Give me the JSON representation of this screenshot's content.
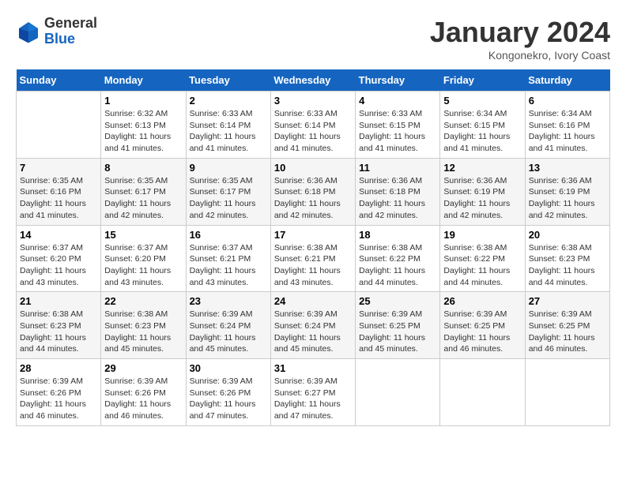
{
  "header": {
    "logo_general": "General",
    "logo_blue": "Blue",
    "title": "January 2024",
    "subtitle": "Kongonekro, Ivory Coast"
  },
  "columns": [
    "Sunday",
    "Monday",
    "Tuesday",
    "Wednesday",
    "Thursday",
    "Friday",
    "Saturday"
  ],
  "weeks": [
    {
      "days": [
        {
          "num": "",
          "info": ""
        },
        {
          "num": "1",
          "info": "Sunrise: 6:32 AM\nSunset: 6:13 PM\nDaylight: 11 hours\nand 41 minutes."
        },
        {
          "num": "2",
          "info": "Sunrise: 6:33 AM\nSunset: 6:14 PM\nDaylight: 11 hours\nand 41 minutes."
        },
        {
          "num": "3",
          "info": "Sunrise: 6:33 AM\nSunset: 6:14 PM\nDaylight: 11 hours\nand 41 minutes."
        },
        {
          "num": "4",
          "info": "Sunrise: 6:33 AM\nSunset: 6:15 PM\nDaylight: 11 hours\nand 41 minutes."
        },
        {
          "num": "5",
          "info": "Sunrise: 6:34 AM\nSunset: 6:15 PM\nDaylight: 11 hours\nand 41 minutes."
        },
        {
          "num": "6",
          "info": "Sunrise: 6:34 AM\nSunset: 6:16 PM\nDaylight: 11 hours\nand 41 minutes."
        }
      ]
    },
    {
      "days": [
        {
          "num": "7",
          "info": "Sunrise: 6:35 AM\nSunset: 6:16 PM\nDaylight: 11 hours\nand 41 minutes."
        },
        {
          "num": "8",
          "info": "Sunrise: 6:35 AM\nSunset: 6:17 PM\nDaylight: 11 hours\nand 42 minutes."
        },
        {
          "num": "9",
          "info": "Sunrise: 6:35 AM\nSunset: 6:17 PM\nDaylight: 11 hours\nand 42 minutes."
        },
        {
          "num": "10",
          "info": "Sunrise: 6:36 AM\nSunset: 6:18 PM\nDaylight: 11 hours\nand 42 minutes."
        },
        {
          "num": "11",
          "info": "Sunrise: 6:36 AM\nSunset: 6:18 PM\nDaylight: 11 hours\nand 42 minutes."
        },
        {
          "num": "12",
          "info": "Sunrise: 6:36 AM\nSunset: 6:19 PM\nDaylight: 11 hours\nand 42 minutes."
        },
        {
          "num": "13",
          "info": "Sunrise: 6:36 AM\nSunset: 6:19 PM\nDaylight: 11 hours\nand 42 minutes."
        }
      ]
    },
    {
      "days": [
        {
          "num": "14",
          "info": "Sunrise: 6:37 AM\nSunset: 6:20 PM\nDaylight: 11 hours\nand 43 minutes."
        },
        {
          "num": "15",
          "info": "Sunrise: 6:37 AM\nSunset: 6:20 PM\nDaylight: 11 hours\nand 43 minutes."
        },
        {
          "num": "16",
          "info": "Sunrise: 6:37 AM\nSunset: 6:21 PM\nDaylight: 11 hours\nand 43 minutes."
        },
        {
          "num": "17",
          "info": "Sunrise: 6:38 AM\nSunset: 6:21 PM\nDaylight: 11 hours\nand 43 minutes."
        },
        {
          "num": "18",
          "info": "Sunrise: 6:38 AM\nSunset: 6:22 PM\nDaylight: 11 hours\nand 44 minutes."
        },
        {
          "num": "19",
          "info": "Sunrise: 6:38 AM\nSunset: 6:22 PM\nDaylight: 11 hours\nand 44 minutes."
        },
        {
          "num": "20",
          "info": "Sunrise: 6:38 AM\nSunset: 6:23 PM\nDaylight: 11 hours\nand 44 minutes."
        }
      ]
    },
    {
      "days": [
        {
          "num": "21",
          "info": "Sunrise: 6:38 AM\nSunset: 6:23 PM\nDaylight: 11 hours\nand 44 minutes."
        },
        {
          "num": "22",
          "info": "Sunrise: 6:38 AM\nSunset: 6:23 PM\nDaylight: 11 hours\nand 45 minutes."
        },
        {
          "num": "23",
          "info": "Sunrise: 6:39 AM\nSunset: 6:24 PM\nDaylight: 11 hours\nand 45 minutes."
        },
        {
          "num": "24",
          "info": "Sunrise: 6:39 AM\nSunset: 6:24 PM\nDaylight: 11 hours\nand 45 minutes."
        },
        {
          "num": "25",
          "info": "Sunrise: 6:39 AM\nSunset: 6:25 PM\nDaylight: 11 hours\nand 45 minutes."
        },
        {
          "num": "26",
          "info": "Sunrise: 6:39 AM\nSunset: 6:25 PM\nDaylight: 11 hours\nand 46 minutes."
        },
        {
          "num": "27",
          "info": "Sunrise: 6:39 AM\nSunset: 6:25 PM\nDaylight: 11 hours\nand 46 minutes."
        }
      ]
    },
    {
      "days": [
        {
          "num": "28",
          "info": "Sunrise: 6:39 AM\nSunset: 6:26 PM\nDaylight: 11 hours\nand 46 minutes."
        },
        {
          "num": "29",
          "info": "Sunrise: 6:39 AM\nSunset: 6:26 PM\nDaylight: 11 hours\nand 46 minutes."
        },
        {
          "num": "30",
          "info": "Sunrise: 6:39 AM\nSunset: 6:26 PM\nDaylight: 11 hours\nand 47 minutes."
        },
        {
          "num": "31",
          "info": "Sunrise: 6:39 AM\nSunset: 6:27 PM\nDaylight: 11 hours\nand 47 minutes."
        },
        {
          "num": "",
          "info": ""
        },
        {
          "num": "",
          "info": ""
        },
        {
          "num": "",
          "info": ""
        }
      ]
    }
  ]
}
